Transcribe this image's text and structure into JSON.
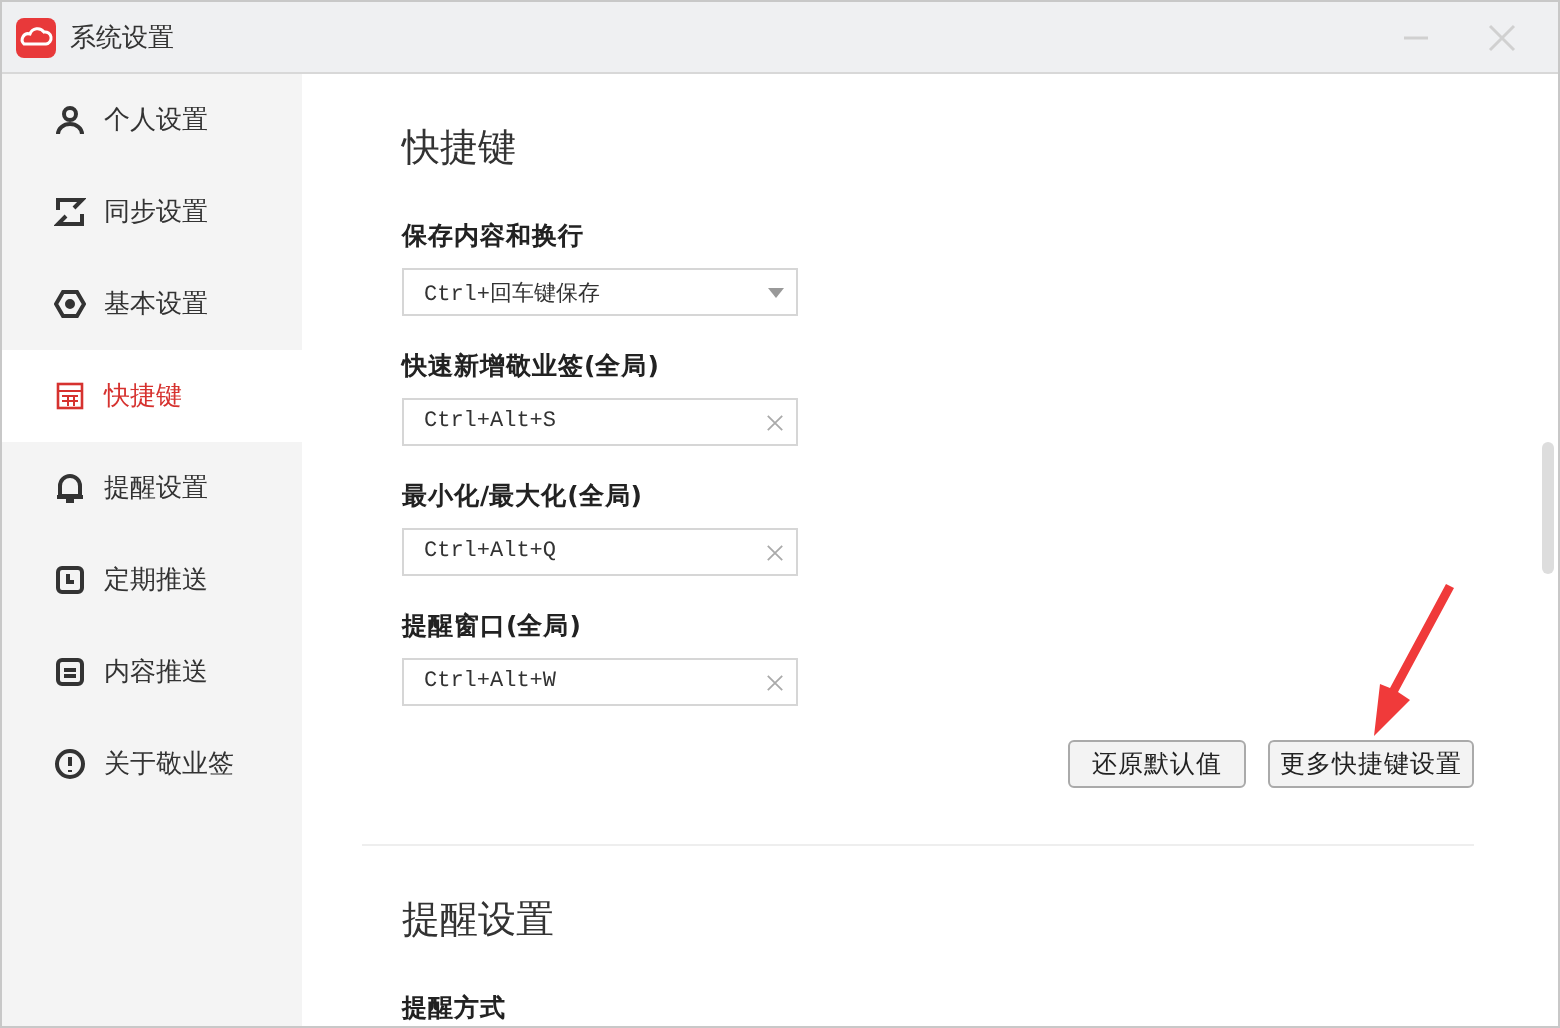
{
  "window": {
    "title": "系统设置"
  },
  "sidebar": {
    "items": [
      {
        "label": "个人设置",
        "selected": false
      },
      {
        "label": "同步设置",
        "selected": false
      },
      {
        "label": "基本设置",
        "selected": false
      },
      {
        "label": "快捷键",
        "selected": true
      },
      {
        "label": "提醒设置",
        "selected": false
      },
      {
        "label": "定期推送",
        "selected": false
      },
      {
        "label": "内容推送",
        "selected": false
      },
      {
        "label": "关于敬业签",
        "selected": false
      }
    ]
  },
  "sections": [
    {
      "heading": "快捷键",
      "fields": [
        {
          "label": "保存内容和换行",
          "kind": "select",
          "value": "Ctrl+回车键保存"
        },
        {
          "label": "快速新增敬业签(全局)",
          "kind": "input",
          "value": "Ctrl+Alt+S"
        },
        {
          "label": "最小化/最大化(全局)",
          "kind": "input",
          "value": "Ctrl+Alt+Q"
        },
        {
          "label": "提醒窗口(全局)",
          "kind": "input",
          "value": "Ctrl+Alt+W"
        }
      ],
      "buttons": [
        "还原默认值",
        "更多快捷键设置"
      ]
    },
    {
      "heading": "提醒设置",
      "fields": [
        {
          "label": "提醒方式",
          "kind": "none"
        }
      ]
    }
  ]
}
